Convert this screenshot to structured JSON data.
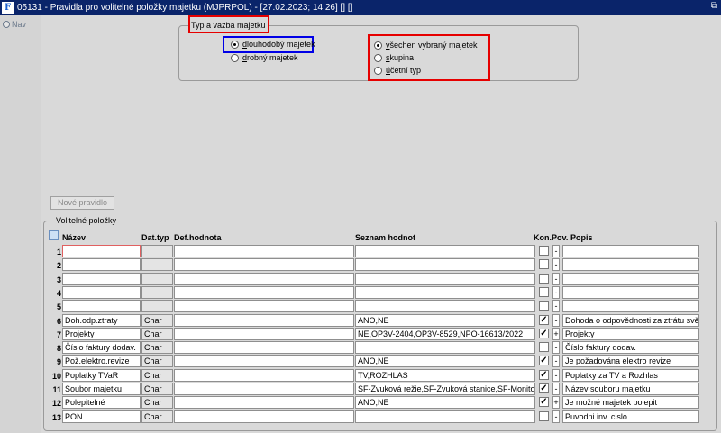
{
  "window": {
    "title": "05131 - Pravidla pro volitelné položky majetku (MJPRPOL) - [27.02.2023; 14:26] [] []",
    "app_icon": "F",
    "restore_glyph": "⧉"
  },
  "nav": {
    "label": "Nav"
  },
  "typ_vazba": {
    "legend": "Typ a vazba majetku",
    "left_options": [
      {
        "label": "dlouhodobý majetek",
        "ul": "d",
        "rest": "louhodobý majetek",
        "selected": true
      },
      {
        "label": "drobný majetek",
        "ul": "d",
        "rest": "robný majetek",
        "selected": false
      }
    ],
    "right_options": [
      {
        "label": "všechen vybraný majetek",
        "ul": "v",
        "rest": "šechen vybraný majetek",
        "selected": true
      },
      {
        "label": "skupina",
        "ul": "s",
        "rest": "kupina",
        "selected": false
      },
      {
        "label": "účetní typ",
        "ul": "ú",
        "rest": "četní typ",
        "selected": false
      }
    ]
  },
  "new_rule_button": "Nové pravidlo",
  "volitelne": {
    "legend": "Volitelné položky",
    "headers": {
      "nazev": "Název",
      "dattyp": "Dat.typ",
      "defhodnota": "Def.hodnota",
      "seznam": "Seznam hodnot",
      "kon": "Kon.",
      "pov": "Pov.",
      "popis": "Popis"
    },
    "rows": [
      {
        "num": "1",
        "nazev": "",
        "dattyp": "",
        "def": "",
        "seznam": "",
        "kon": false,
        "pov": "-",
        "popis": ""
      },
      {
        "num": "2",
        "nazev": "",
        "dattyp": "",
        "def": "",
        "seznam": "",
        "kon": false,
        "pov": "-",
        "popis": ""
      },
      {
        "num": "3",
        "nazev": "",
        "dattyp": "",
        "def": "",
        "seznam": "",
        "kon": false,
        "pov": "-",
        "popis": ""
      },
      {
        "num": "4",
        "nazev": "",
        "dattyp": "",
        "def": "",
        "seznam": "",
        "kon": false,
        "pov": "-",
        "popis": ""
      },
      {
        "num": "5",
        "nazev": "",
        "dattyp": "",
        "def": "",
        "seznam": "",
        "kon": false,
        "pov": "-",
        "popis": ""
      },
      {
        "num": "6",
        "nazev": "Doh.odp.ztraty",
        "dattyp": "Char",
        "def": "",
        "seznam": "ANO,NE",
        "kon": true,
        "pov": "-",
        "popis": "Dohoda o  odpovědnosti za ztrátu svěř"
      },
      {
        "num": "7",
        "nazev": "Projekty",
        "dattyp": "Char",
        "def": "",
        "seznam": "NE,OP3V-2404,OP3V-8529,NPO-16613/2022",
        "kon": true,
        "pov": "+",
        "popis": "Projekty"
      },
      {
        "num": "8",
        "nazev": "Číslo faktury dodav.",
        "dattyp": "Char",
        "def": "",
        "seznam": "",
        "kon": false,
        "pov": "-",
        "popis": "Číslo faktury dodav."
      },
      {
        "num": "9",
        "nazev": "Pož.elektro.revize",
        "dattyp": "Char",
        "def": "",
        "seznam": "ANO,NE",
        "kon": true,
        "pov": "-",
        "popis": "Je požadována elektro revize"
      },
      {
        "num": "10",
        "nazev": "Poplatky TVaR",
        "dattyp": "Char",
        "def": "",
        "seznam": "TV,ROZHLAS",
        "kon": true,
        "pov": "-",
        "popis": "Poplatky za TV a Rozhlas"
      },
      {
        "num": "11",
        "nazev": "Soubor majetku",
        "dattyp": "Char",
        "def": "",
        "seznam": "SF-Zvuková režie,SF-Zvuková stanice,SF-Monitoro",
        "kon": true,
        "pov": "-",
        "popis": "Název souboru majetku"
      },
      {
        "num": "12",
        "nazev": "Polepitelné",
        "dattyp": "Char",
        "def": "",
        "seznam": "ANO,NE",
        "kon": true,
        "pov": "+",
        "popis": "Je možné majetek polepit"
      },
      {
        "num": "13",
        "nazev": "PON",
        "dattyp": "Char",
        "def": "",
        "seznam": "",
        "kon": false,
        "pov": "-",
        "popis": "Puvodni inv. cislo"
      }
    ]
  },
  "colors": {
    "titlebar": "#0a246a",
    "highlight_red": "#e60000",
    "highlight_blue": "#0000e6"
  }
}
